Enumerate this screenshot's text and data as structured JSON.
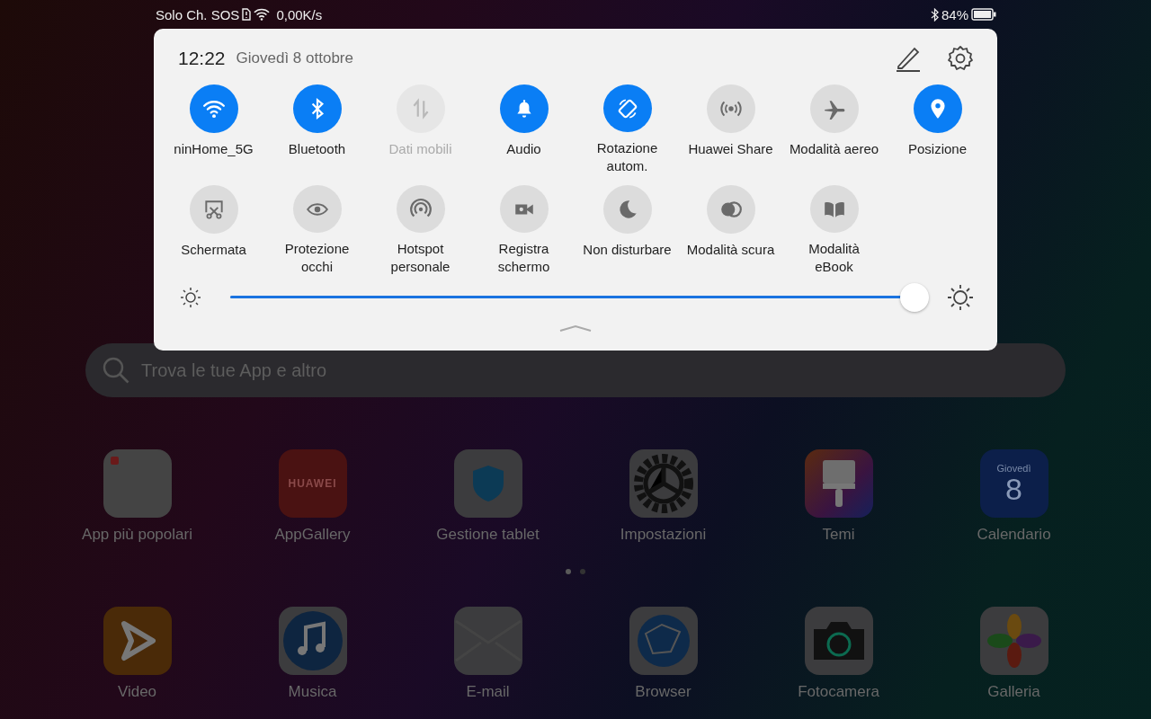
{
  "status_bar": {
    "carrier": "Solo Ch. SOS",
    "speed": "0,00K/s",
    "battery": "84%"
  },
  "panel": {
    "time": "12:22",
    "date": "Giovedì 8 ottobre",
    "tiles": [
      {
        "kind": "wifi",
        "label": "ninHome_5G",
        "on": true,
        "disabled": false
      },
      {
        "kind": "bluetooth",
        "label": "Bluetooth",
        "on": true,
        "disabled": false
      },
      {
        "kind": "data",
        "label": "Dati mobili",
        "on": false,
        "disabled": true
      },
      {
        "kind": "bell",
        "label": "Audio",
        "on": true,
        "disabled": false
      },
      {
        "kind": "rotate",
        "label": "Rotazione autom.",
        "on": true,
        "disabled": false
      },
      {
        "kind": "share",
        "label": "Huawei Share",
        "on": false,
        "disabled": false
      },
      {
        "kind": "plane",
        "label": "Modalità aereo",
        "on": false,
        "disabled": false
      },
      {
        "kind": "pin",
        "label": "Posizione",
        "on": true,
        "disabled": false
      },
      {
        "kind": "screenshot",
        "label": "Schermata",
        "on": false,
        "disabled": false
      },
      {
        "kind": "eye",
        "label": "Protezione occhi",
        "on": false,
        "disabled": false
      },
      {
        "kind": "hotspot",
        "label": "Hotspot personale",
        "on": false,
        "disabled": false
      },
      {
        "kind": "camera",
        "label": "Registra schermo",
        "on": false,
        "disabled": false
      },
      {
        "kind": "moon",
        "label": "Non disturbare",
        "on": false,
        "disabled": false
      },
      {
        "kind": "dark",
        "label": "Modalità scura",
        "on": false,
        "disabled": false
      },
      {
        "kind": "book",
        "label": "Modalità eBook",
        "on": false,
        "disabled": false
      }
    ],
    "brightness": {
      "level": 0.99
    }
  },
  "search": {
    "placeholder": "Trova le tue App e altro"
  },
  "apps": [
    {
      "kind": "folder",
      "label": "App più popolari"
    },
    {
      "kind": "gallery-store",
      "label": "AppGallery",
      "icon_text": "HUAWEI"
    },
    {
      "kind": "shield",
      "label": "Gestione tablet"
    },
    {
      "kind": "gear",
      "label": "Impostazioni"
    },
    {
      "kind": "brush",
      "label": "Temi"
    },
    {
      "kind": "calendar",
      "label": "Calendario",
      "icon_text": "Giovedì",
      "icon_number": "8"
    },
    {
      "kind": "video",
      "label": "Video"
    },
    {
      "kind": "music",
      "label": "Musica"
    },
    {
      "kind": "mail",
      "label": "E-mail"
    },
    {
      "kind": "globe",
      "label": "Browser"
    },
    {
      "kind": "photo",
      "label": "Fotocamera"
    },
    {
      "kind": "flower",
      "label": "Galleria"
    }
  ],
  "page_dots": [
    {
      "selected": true
    },
    {
      "selected": false
    }
  ]
}
